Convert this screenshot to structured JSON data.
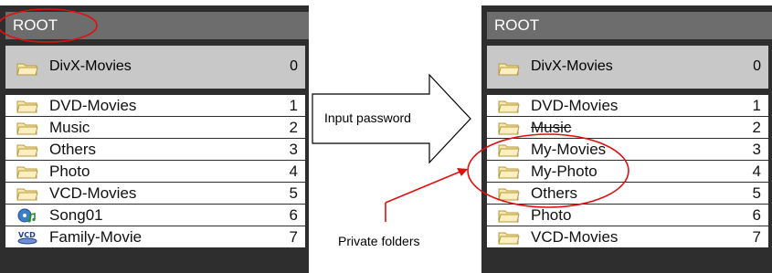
{
  "left_panel": {
    "header": "ROOT",
    "selected": {
      "name": "DivX-Movies",
      "num": "0",
      "icon": "folder-icon"
    },
    "items": [
      {
        "name": "DVD-Movies",
        "num": "1",
        "icon": "folder-icon"
      },
      {
        "name": "Music",
        "num": "2",
        "icon": "folder-icon"
      },
      {
        "name": "Others",
        "num": "3",
        "icon": "folder-icon"
      },
      {
        "name": "Photo",
        "num": "4",
        "icon": "folder-icon"
      },
      {
        "name": "VCD-Movies",
        "num": "5",
        "icon": "folder-icon"
      },
      {
        "name": "Song01",
        "num": "6",
        "icon": "music-disc-icon"
      },
      {
        "name": "Family-Movie",
        "num": "7",
        "icon": "vcd-disc-icon"
      }
    ]
  },
  "right_panel": {
    "header": "ROOT",
    "selected": {
      "name": "DivX-Movies",
      "num": "0",
      "icon": "folder-icon"
    },
    "items": [
      {
        "name": "DVD-Movies",
        "num": "1",
        "icon": "folder-icon"
      },
      {
        "name": "Music",
        "num": "2",
        "icon": "folder-icon"
      },
      {
        "name": "My-Movies",
        "num": "3",
        "icon": "folder-icon"
      },
      {
        "name": "My-Photo",
        "num": "4",
        "icon": "folder-icon"
      },
      {
        "name": "Others",
        "num": "5",
        "icon": "folder-icon"
      },
      {
        "name": "Photo",
        "num": "6",
        "icon": "folder-icon"
      },
      {
        "name": "VCD-Movies",
        "num": "7",
        "icon": "folder-icon"
      }
    ]
  },
  "arrow_label": "Input password",
  "callout_label": "Private folders",
  "colors": {
    "highlight_ring": "#e01010",
    "header_bg": "#6d6d6d",
    "panel_frame": "#2e2e2e",
    "selected_bg": "#c8c8c8"
  }
}
